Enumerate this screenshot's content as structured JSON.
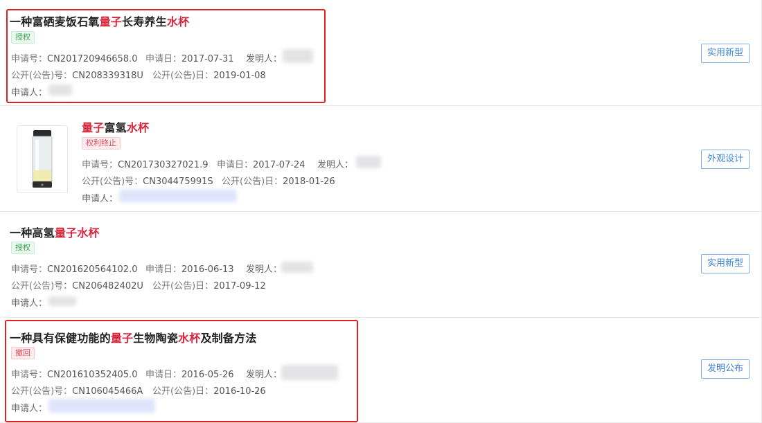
{
  "patents": [
    {
      "title": {
        "pre": "一种富硒麦饭石氧",
        "h1": "量子",
        "mid": "长寿养生",
        "h2": "水杯",
        "post": ""
      },
      "status": "授权",
      "application_no_label": "申请号：",
      "application_no": "CN201720946658.0",
      "application_date_label": "申请日：",
      "application_date": "2017-07-31",
      "inventor_label": "发明人：",
      "publication_no_label": "公开(公告)号：",
      "publication_no": "CN208339318U",
      "publication_date_label": "公开(公告)日：",
      "publication_date": "2019-01-08",
      "applicant_label": "申请人：",
      "type": "实用新型"
    },
    {
      "title": {
        "pre": "",
        "h1": "量子",
        "mid": "富氢",
        "h2": "水杯",
        "post": ""
      },
      "status": "权利终止",
      "application_no_label": "申请号：",
      "application_no": "CN201730327021.9",
      "application_date_label": "申请日：",
      "application_date": "2017-07-24",
      "inventor_label": "发明人：",
      "publication_no_label": "公开(公告)号：",
      "publication_no": "CN304475991S",
      "publication_date_label": "公开(公告)日：",
      "publication_date": "2018-01-26",
      "applicant_label": "申请人：",
      "type": "外观设计"
    },
    {
      "title": {
        "pre": "一种高氢",
        "h1": "量子",
        "mid": "",
        "h2": "水杯",
        "post": ""
      },
      "status": "授权",
      "application_no_label": "申请号：",
      "application_no": "CN201620564102.0",
      "application_date_label": "申请日：",
      "application_date": "2016-06-13",
      "inventor_label": "发明人：",
      "publication_no_label": "公开(公告)号：",
      "publication_no": "CN206482402U",
      "publication_date_label": "公开(公告)日：",
      "publication_date": "2017-09-12",
      "applicant_label": "申请人：",
      "type": "实用新型"
    },
    {
      "title": {
        "pre": "一种具有保健功能的",
        "h1": "量子",
        "mid": "生物陶瓷",
        "h2": "水杯",
        "post": "及制备方法"
      },
      "status": "撤回",
      "application_no_label": "申请号：",
      "application_no": "CN201610352405.0",
      "application_date_label": "申请日：",
      "application_date": "2016-05-26",
      "inventor_label": "发明人：",
      "publication_no_label": "公开(公告)号：",
      "publication_no": "CN106045466A",
      "publication_date_label": "公开(公告)日：",
      "publication_date": "2016-10-26",
      "applicant_label": "申请人：",
      "type": "发明公布"
    }
  ],
  "colors": {
    "highlight": "#d7263d",
    "annotation_box": "#e02020",
    "type_button": "#3b82d6"
  }
}
